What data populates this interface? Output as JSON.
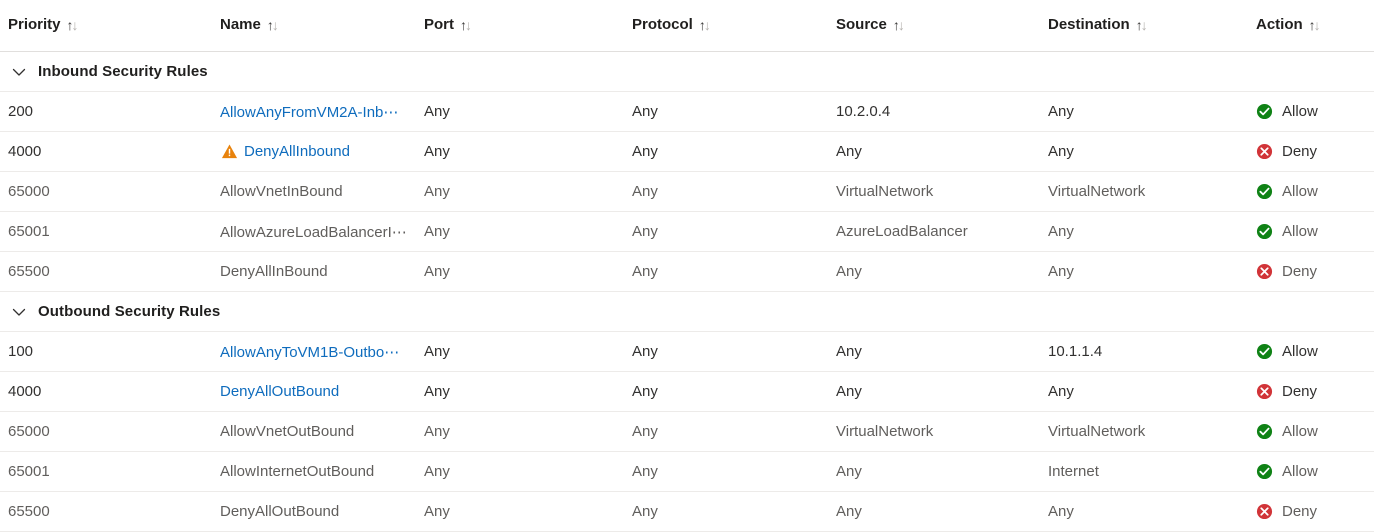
{
  "table": {
    "columns": [
      {
        "key": "priority",
        "label": "Priority",
        "sort": "↑↓"
      },
      {
        "key": "name",
        "label": "Name",
        "sort": "↑↓"
      },
      {
        "key": "port",
        "label": "Port",
        "sort": "↑↓"
      },
      {
        "key": "protocol",
        "label": "Protocol",
        "sort": "↑↓"
      },
      {
        "key": "source",
        "label": "Source",
        "sort": "↑↓"
      },
      {
        "key": "destination",
        "label": "Destination",
        "sort": "↑↓"
      },
      {
        "key": "action",
        "label": "Action",
        "sort": "↑↓"
      }
    ],
    "groups": [
      {
        "id": "inbound",
        "label": "Inbound Security Rules",
        "expanded": true,
        "chevron_icon": "chevron-down-icon",
        "rows": [
          {
            "priority": "200",
            "name": "AllowAnyFromVM2A-Inb⋯",
            "name_is_link": true,
            "warning": false,
            "port": "Any",
            "protocol": "Any",
            "source": "10.2.0.4",
            "destination": "Any",
            "action": "Allow",
            "action_icon": "allow-check-icon",
            "editable": true
          },
          {
            "priority": "4000",
            "name": "DenyAllInbound",
            "name_is_link": true,
            "warning": true,
            "warning_icon": "warning-triangle-icon",
            "port": "Any",
            "protocol": "Any",
            "source": "Any",
            "destination": "Any",
            "action": "Deny",
            "action_icon": "deny-cross-icon",
            "editable": true
          },
          {
            "priority": "65000",
            "name": "AllowVnetInBound",
            "name_is_link": false,
            "warning": false,
            "port": "Any",
            "protocol": "Any",
            "source": "VirtualNetwork",
            "destination": "VirtualNetwork",
            "action": "Allow",
            "action_icon": "allow-check-icon",
            "editable": false
          },
          {
            "priority": "65001",
            "name": "AllowAzureLoadBalancerI⋯",
            "name_is_link": false,
            "warning": false,
            "port": "Any",
            "protocol": "Any",
            "source": "AzureLoadBalancer",
            "destination": "Any",
            "action": "Allow",
            "action_icon": "allow-check-icon",
            "editable": false
          },
          {
            "priority": "65500",
            "name": "DenyAllInBound",
            "name_is_link": false,
            "warning": false,
            "port": "Any",
            "protocol": "Any",
            "source": "Any",
            "destination": "Any",
            "action": "Deny",
            "action_icon": "deny-cross-icon",
            "editable": false
          }
        ]
      },
      {
        "id": "outbound",
        "label": "Outbound Security Rules",
        "expanded": true,
        "chevron_icon": "chevron-down-icon",
        "rows": [
          {
            "priority": "100",
            "name": "AllowAnyToVM1B-Outbo⋯",
            "name_is_link": true,
            "warning": false,
            "port": "Any",
            "protocol": "Any",
            "source": "Any",
            "destination": "10.1.1.4",
            "action": "Allow",
            "action_icon": "allow-check-icon",
            "editable": true
          },
          {
            "priority": "4000",
            "name": "DenyAllOutBound",
            "name_is_link": true,
            "warning": false,
            "port": "Any",
            "protocol": "Any",
            "source": "Any",
            "destination": "Any",
            "action": "Deny",
            "action_icon": "deny-cross-icon",
            "editable": true
          },
          {
            "priority": "65000",
            "name": "AllowVnetOutBound",
            "name_is_link": false,
            "warning": false,
            "port": "Any",
            "protocol": "Any",
            "source": "VirtualNetwork",
            "destination": "VirtualNetwork",
            "action": "Allow",
            "action_icon": "allow-check-icon",
            "editable": false
          },
          {
            "priority": "65001",
            "name": "AllowInternetOutBound",
            "name_is_link": false,
            "warning": false,
            "port": "Any",
            "protocol": "Any",
            "source": "Any",
            "destination": "Internet",
            "action": "Allow",
            "action_icon": "allow-check-icon",
            "editable": false
          },
          {
            "priority": "65500",
            "name": "DenyAllOutBound",
            "name_is_link": false,
            "warning": false,
            "port": "Any",
            "protocol": "Any",
            "source": "Any",
            "destination": "Any",
            "action": "Deny",
            "action_icon": "deny-cross-icon",
            "editable": false
          }
        ]
      }
    ]
  },
  "colors": {
    "link": "#0f6cbd",
    "allow": "#0f8215",
    "deny": "#d13438",
    "warning": "#e8820c",
    "text": "#323130",
    "text_muted": "#605e5c",
    "divider": "#edebe9"
  }
}
